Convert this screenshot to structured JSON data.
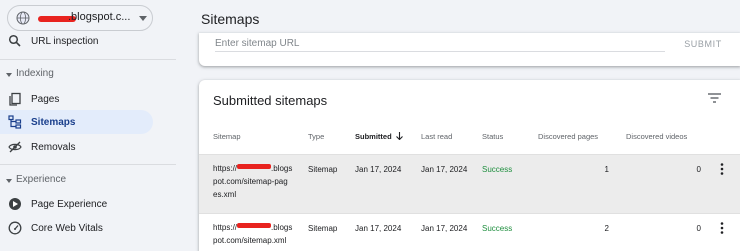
{
  "sidebar": {
    "property": {
      "label": ".blogspot.c...",
      "globe_icon": "globe-icon",
      "caret_icon": "caret-down-icon"
    },
    "url_inspection": {
      "label": "URL inspection",
      "icon": "search-icon"
    },
    "indexing": {
      "heading": "Indexing",
      "items": [
        {
          "label": "Pages",
          "icon": "pages-icon",
          "active": false
        },
        {
          "label": "Sitemaps",
          "icon": "sitemap-icon",
          "active": true
        },
        {
          "label": "Removals",
          "icon": "removals-icon",
          "active": false
        }
      ]
    },
    "experience": {
      "heading": "Experience",
      "items": [
        {
          "label": "Page Experience",
          "icon": "page-experience-icon"
        },
        {
          "label": "Core Web Vitals",
          "icon": "gauge-icon"
        }
      ]
    }
  },
  "main": {
    "title": "Sitemaps",
    "add_sitemap": {
      "placeholder": "Enter sitemap URL",
      "submit_label": "SUBMIT"
    },
    "submitted": {
      "title": "Submitted sitemaps",
      "columns": [
        "Sitemap",
        "Type",
        "Submitted",
        "Last read",
        "Status",
        "Discovered pages",
        "Discovered videos"
      ],
      "sorted_column": "Submitted",
      "rows": [
        {
          "url_prefix": "https://",
          "url_line1_suffix": ".blogs",
          "url_line2": "pot.com/sitemap-pag",
          "url_line3": "es.xml",
          "type": "Sitemap",
          "submitted": "Jan 17, 2024",
          "last_read": "Jan 17, 2024",
          "status": "Success",
          "discovered_pages": "1",
          "discovered_videos": "0"
        },
        {
          "url_prefix": "https://",
          "url_line1_suffix": ".blogs",
          "url_line2": "pot.com/sitemap.xml",
          "url_line3": "",
          "type": "Sitemap",
          "submitted": "Jan 17, 2024",
          "last_read": "Jan 17, 2024",
          "status": "Success",
          "discovered_pages": "2",
          "discovered_videos": "0"
        }
      ]
    }
  },
  "colors": {
    "background": "#f1f3f7",
    "active_nav": "#e3ecfb",
    "success": "#1e8e3e",
    "redaction": "#e8231f"
  }
}
